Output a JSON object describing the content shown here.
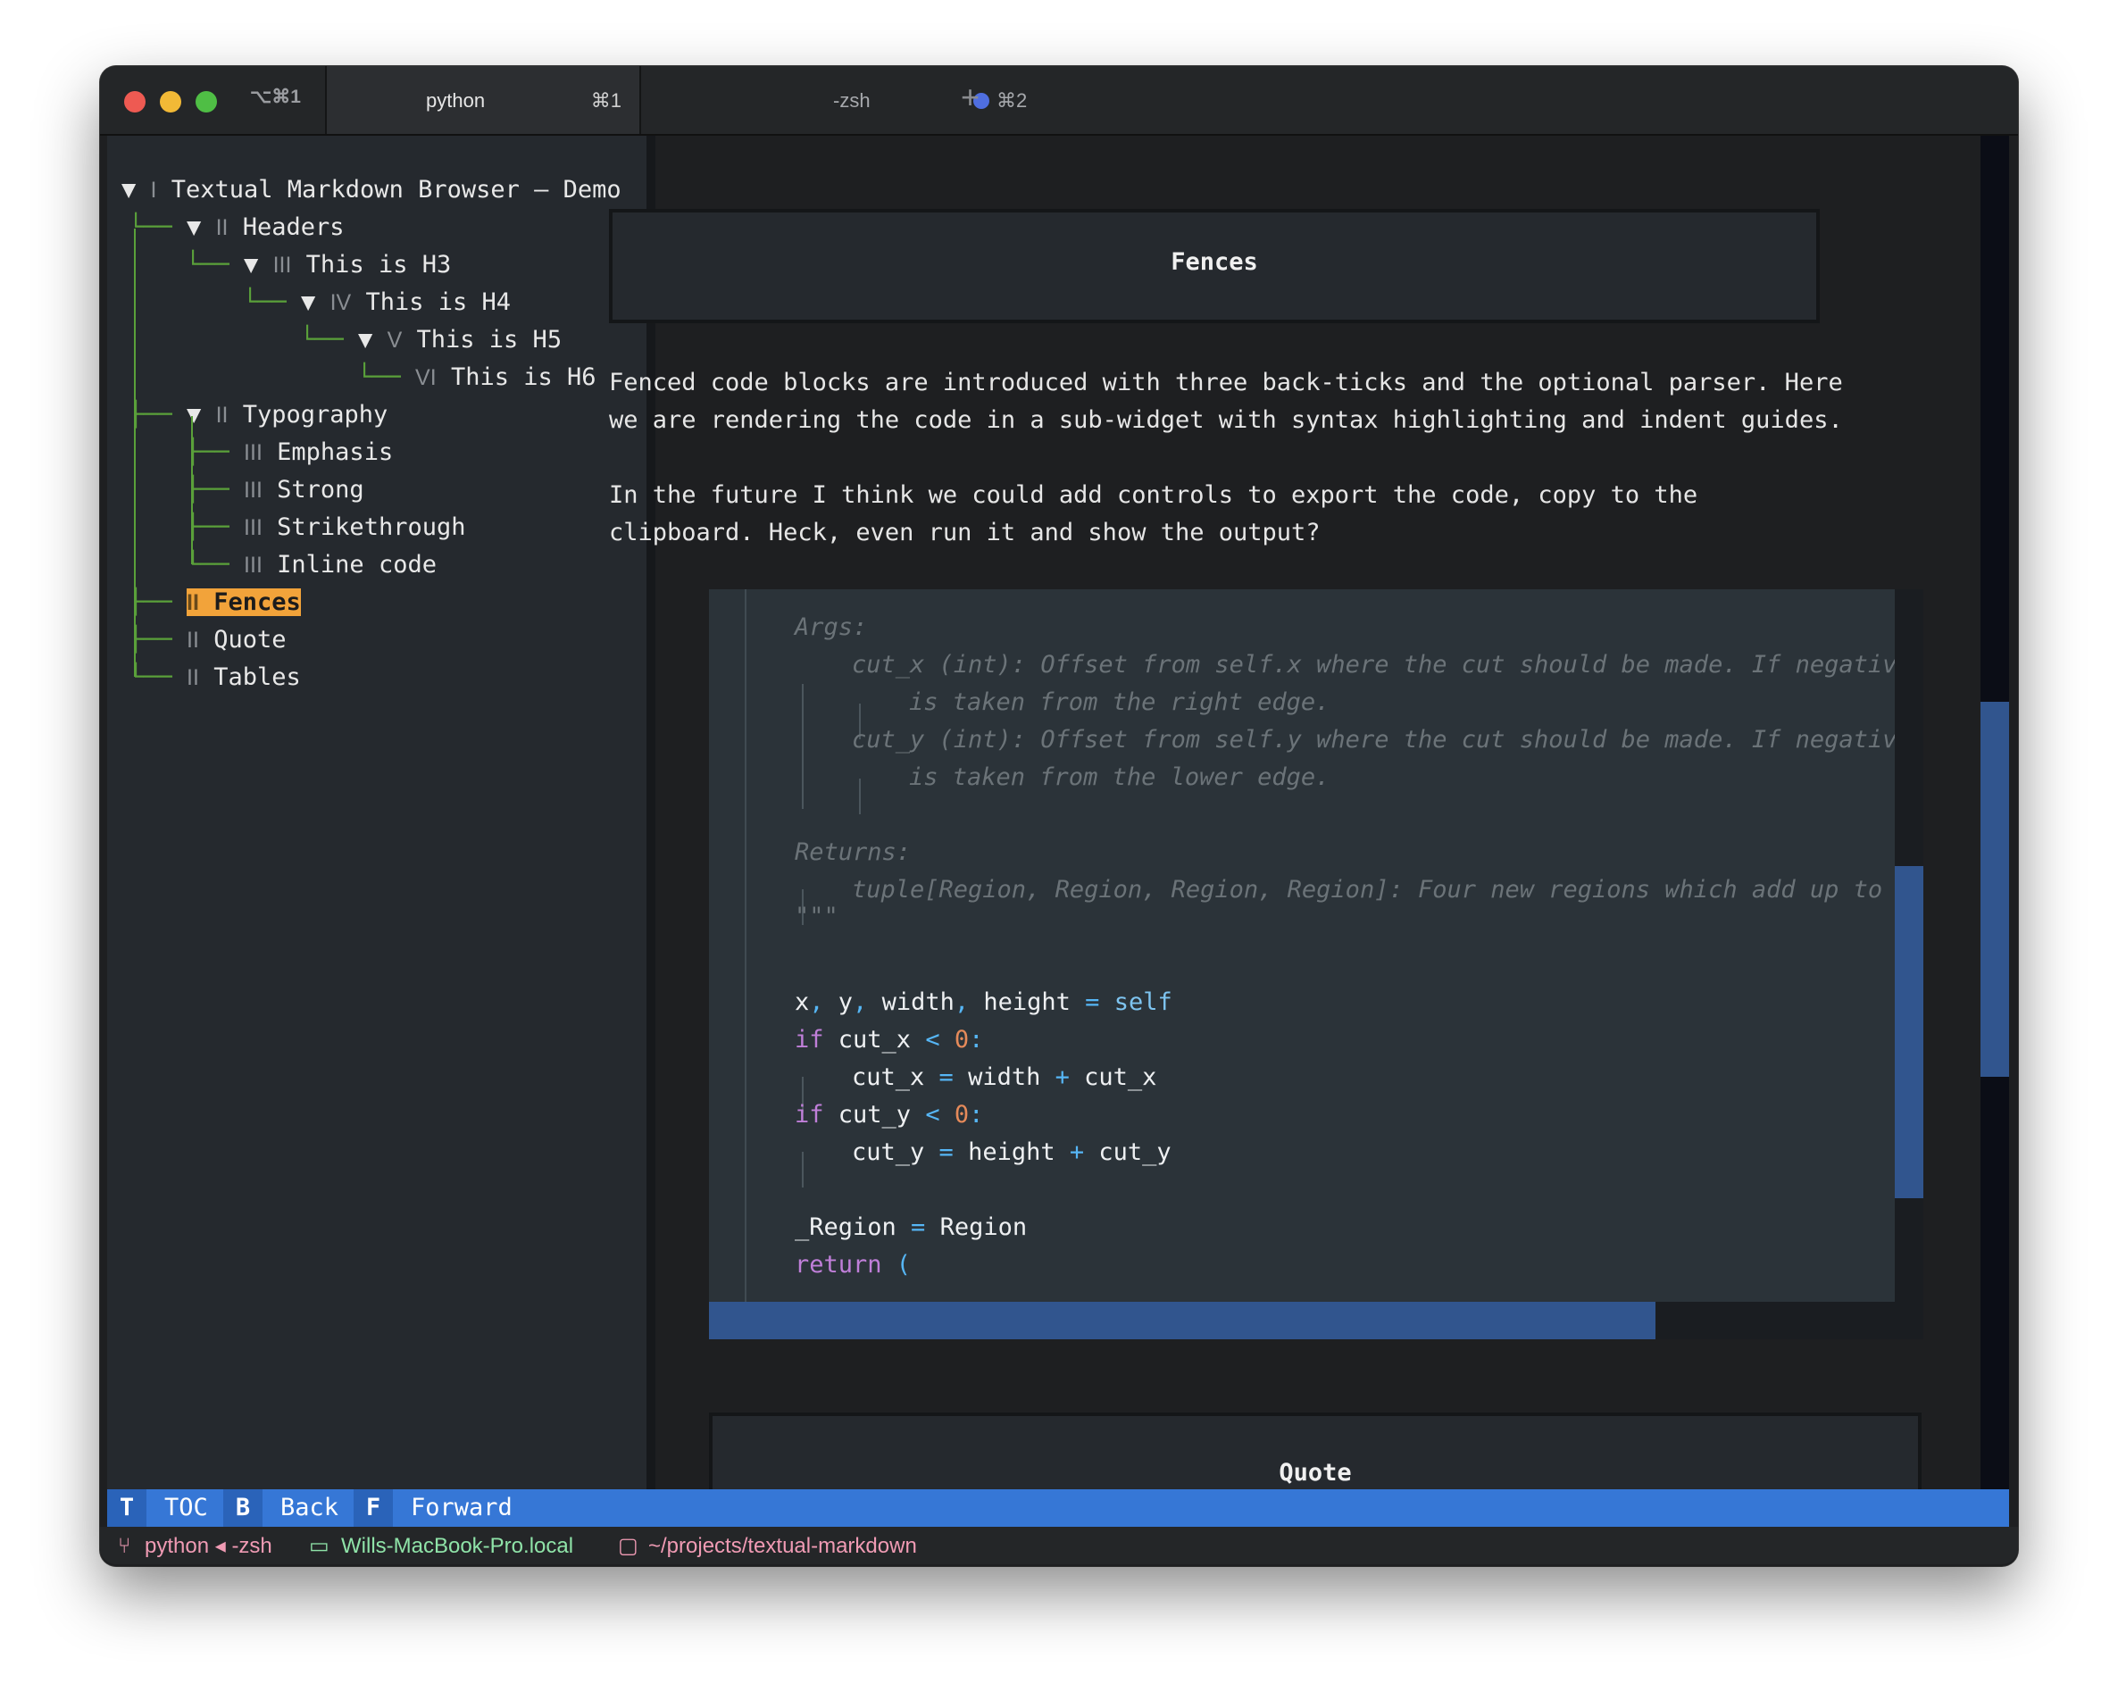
{
  "window": {
    "shortcut": "⌥⌘1",
    "tabs": [
      {
        "title": "python",
        "key": "⌘1",
        "active": true
      },
      {
        "title": "-zsh",
        "key": "⌘2",
        "active": false
      }
    ],
    "new_tab": "+"
  },
  "toc": {
    "items": [
      {
        "prefix": "▼ ",
        "roman": "I",
        "label": "Textual Markdown Browser – Demo"
      },
      {
        "prefix": "▼ ",
        "roman": "II",
        "label": "Headers"
      },
      {
        "prefix": "▼ ",
        "roman": "III",
        "label": "This is H3"
      },
      {
        "prefix": "▼ ",
        "roman": "IV",
        "label": "This is H4"
      },
      {
        "prefix": "▼ ",
        "roman": "V",
        "label": "This is H5"
      },
      {
        "prefix": "",
        "roman": "VI",
        "label": "This is H6"
      },
      {
        "prefix": "▼ ",
        "roman": "II",
        "label": "Typography"
      },
      {
        "prefix": "",
        "roman": "III",
        "label": "Emphasis"
      },
      {
        "prefix": "",
        "roman": "III",
        "label": "Strong"
      },
      {
        "prefix": "",
        "roman": "III",
        "label": "Strikethrough"
      },
      {
        "prefix": "",
        "roman": "III",
        "label": "Inline code"
      },
      {
        "prefix": "",
        "roman": "II",
        "label": "Fences",
        "selected": true
      },
      {
        "prefix": "",
        "roman": "II",
        "label": "Quote"
      },
      {
        "prefix": "",
        "roman": "II",
        "label": "Tables"
      }
    ]
  },
  "document": {
    "fences_heading": "Fences",
    "paragraph1": [
      "Fenced code blocks are introduced with three back-ticks and the optional parser. Here",
      "we are rendering the code in a sub-widget with syntax highlighting and indent guides."
    ],
    "paragraph2": [
      "In the future I think we could add controls to export the code, copy to the",
      "clipboard. Heck, even run it and show the output?"
    ],
    "code": {
      "args_label": "Args:",
      "cut_x_doc": "cut_x (int): Offset from self.x where the cut should be made. If negative",
      "cut_x_doc2": "is taken from the right edge.",
      "cut_y_doc": "cut_y (int): Offset from self.y where the cut should be made. If negative",
      "cut_y_doc2": "is taken from the lower edge.",
      "returns_label": "Returns:",
      "returns_doc": "tuple[Region, Region, Region, Region]: Four new regions which add up to t",
      "docstring_end": "\"\"\"",
      "l_unpack_a": "x",
      "l_unpack_b": ",",
      "l_unpack_c": " y",
      "l_unpack_d": ",",
      "l_unpack_e": " width",
      "l_unpack_f": ",",
      "l_unpack_g": " height ",
      "l_unpack_eq": "=",
      "l_unpack_self": " self",
      "kw_if": "if",
      "cut_x_var": " cut_x ",
      "lt": "<",
      "zero": " 0",
      "colon": ":",
      "cut_x_assign": "cut_x ",
      "eq": "=",
      "width_plus": " width ",
      "plus": "+",
      "cut_x_tail": " cut_x",
      "cut_y_var": " cut_y ",
      "cut_y_assign": "cut_y ",
      "height_plus": " height ",
      "cut_y_tail": " cut_y",
      "region_a": "_Region ",
      "region_b": " Region",
      "kw_return": "return",
      "paren": " ("
    },
    "quote_heading": "Quote"
  },
  "footer": {
    "bindings": [
      {
        "key": "T",
        "label": "TOC"
      },
      {
        "key": "B",
        "label": "Back"
      },
      {
        "key": "F",
        "label": "Forward"
      }
    ]
  },
  "statusbar": {
    "process": "python ◂ -zsh",
    "host": "Wills-MacBook-Pro.local",
    "path": "~/projects/textual-markdown"
  },
  "colors": {
    "accent_blue": "#3677d6",
    "selection_orange": "#f2a33a",
    "tree_line_green": "#5aa03a",
    "scrollbar_thumb": "#31558e",
    "status_pink": "#f09bb4",
    "status_green": "#8fe3a8"
  },
  "icons": [
    "close-icon",
    "minimize-icon",
    "zoom-icon",
    "branch-icon",
    "laptop-icon",
    "folder-icon"
  ]
}
